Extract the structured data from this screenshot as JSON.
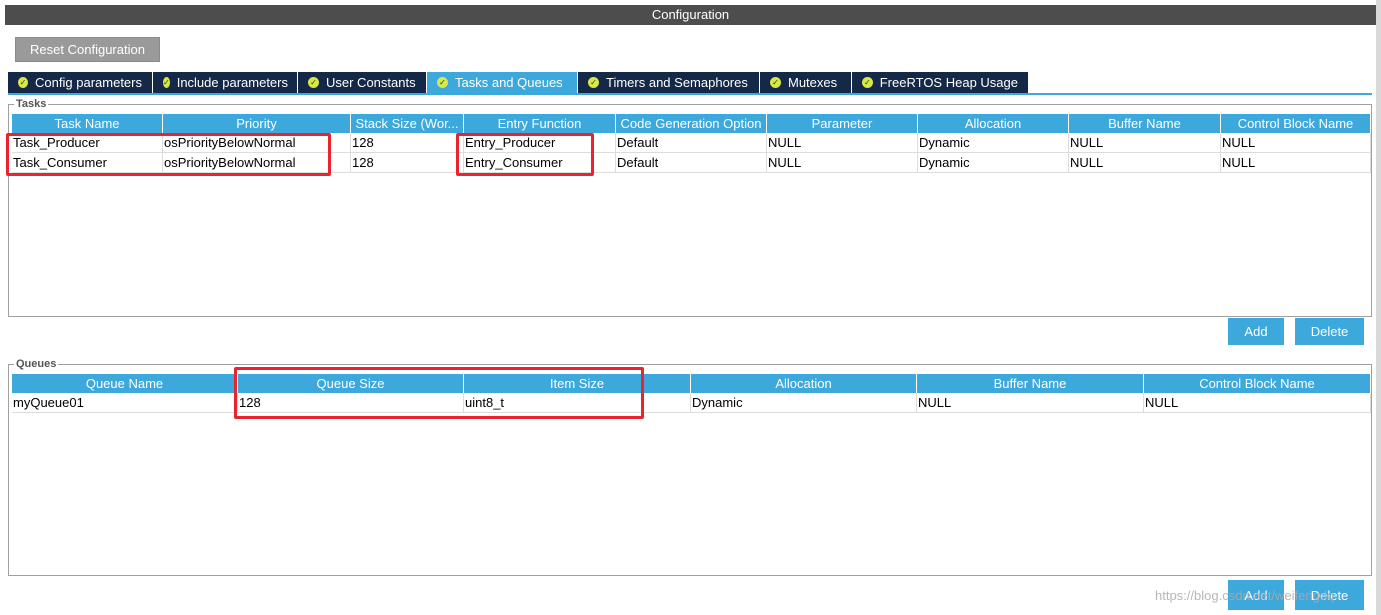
{
  "window": {
    "title": "Configuration"
  },
  "toolbar": {
    "reset_label": "Reset Configuration"
  },
  "tabs": [
    {
      "label": "Config parameters",
      "active": false
    },
    {
      "label": "Include parameters",
      "active": false
    },
    {
      "label": "User Constants",
      "active": false
    },
    {
      "label": "Tasks and Queues",
      "active": true
    },
    {
      "label": "Timers and Semaphores",
      "active": false
    },
    {
      "label": "Mutexes",
      "active": false
    },
    {
      "label": "FreeRTOS Heap Usage",
      "active": false
    }
  ],
  "tasks": {
    "label": "Tasks",
    "columns": [
      "Task Name",
      "Priority",
      "Stack Size (Wor...",
      "Entry Function",
      "Code Generation Option",
      "Parameter",
      "Allocation",
      "Buffer Name",
      "Control Block Name"
    ],
    "rows": [
      [
        "Task_Producer",
        "osPriorityBelowNormal",
        "128",
        "Entry_Producer",
        "Default",
        "NULL",
        "Dynamic",
        "NULL",
        "NULL"
      ],
      [
        "Task_Consumer",
        "osPriorityBelowNormal",
        "128",
        "Entry_Consumer",
        "Default",
        "NULL",
        "Dynamic",
        "NULL",
        "NULL"
      ]
    ],
    "add_label": "Add",
    "delete_label": "Delete"
  },
  "queues": {
    "label": "Queues",
    "columns": [
      "Queue Name",
      "Queue Size",
      "Item Size",
      "Allocation",
      "Buffer Name",
      "Control Block Name"
    ],
    "rows": [
      [
        "myQueue01",
        "128",
        "uint8_t",
        "Dynamic",
        "NULL",
        "NULL"
      ]
    ],
    "add_label": "Add",
    "delete_label": "Delete"
  },
  "watermark": "https://blog.csdn.net/weifengdq",
  "colors": {
    "header": "#3da8db",
    "tab_bg": "#142848",
    "highlight": "#e8252e",
    "title_bar": "#4d4d4d"
  }
}
